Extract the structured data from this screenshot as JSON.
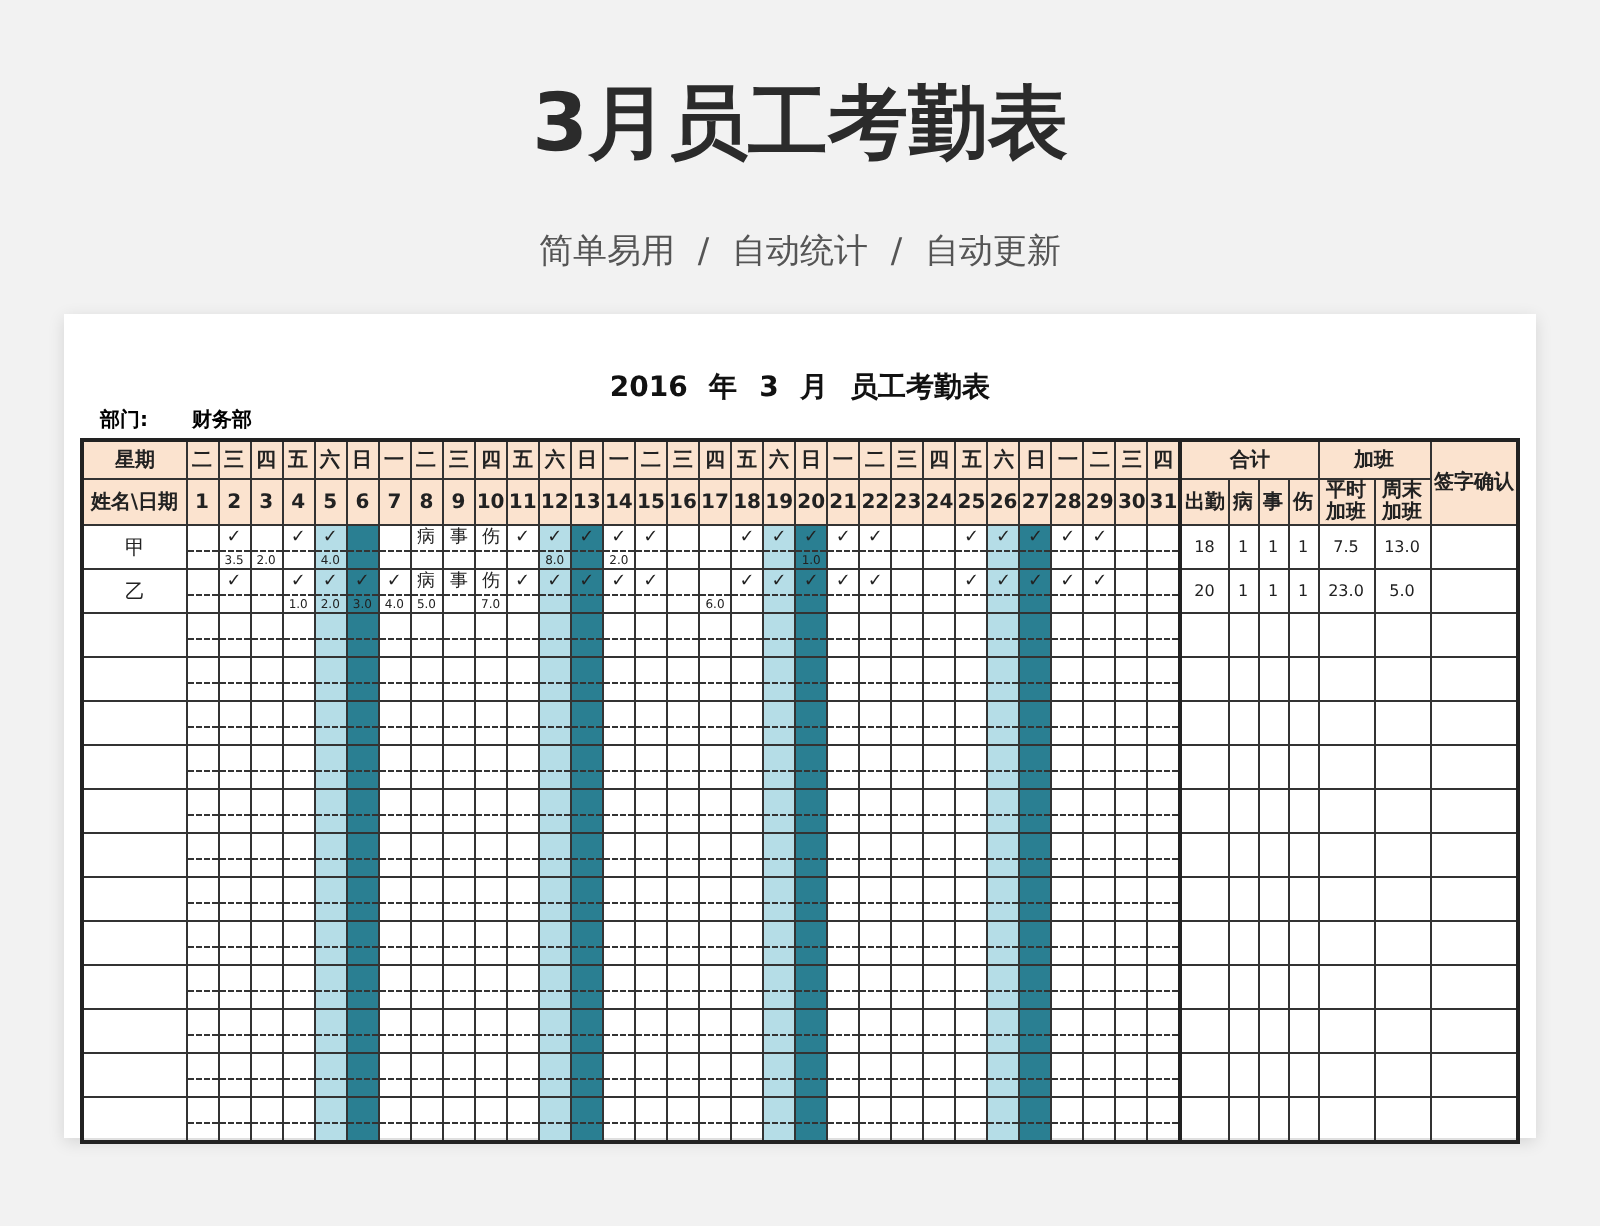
{
  "title": "3月员工考勤表",
  "subtitle": "简单易用 / 自动统计 / 自动更新",
  "sheet": {
    "title": "2016 年 3 月 员工考勤表",
    "department_label": "部门:",
    "department": "财务部",
    "weekday_header": "星期",
    "name_date_header": "姓名\\日期",
    "days": [
      {
        "weekday": "二",
        "date": "1",
        "kind": "weekday"
      },
      {
        "weekday": "三",
        "date": "2",
        "kind": "weekday"
      },
      {
        "weekday": "四",
        "date": "3",
        "kind": "weekday"
      },
      {
        "weekday": "五",
        "date": "4",
        "kind": "weekday"
      },
      {
        "weekday": "六",
        "date": "5",
        "kind": "saturday"
      },
      {
        "weekday": "日",
        "date": "6",
        "kind": "sunday"
      },
      {
        "weekday": "一",
        "date": "7",
        "kind": "weekday"
      },
      {
        "weekday": "二",
        "date": "8",
        "kind": "weekday"
      },
      {
        "weekday": "三",
        "date": "9",
        "kind": "weekday"
      },
      {
        "weekday": "四",
        "date": "10",
        "kind": "weekday"
      },
      {
        "weekday": "五",
        "date": "11",
        "kind": "weekday"
      },
      {
        "weekday": "六",
        "date": "12",
        "kind": "saturday"
      },
      {
        "weekday": "日",
        "date": "13",
        "kind": "sunday"
      },
      {
        "weekday": "一",
        "date": "14",
        "kind": "weekday"
      },
      {
        "weekday": "二",
        "date": "15",
        "kind": "weekday"
      },
      {
        "weekday": "三",
        "date": "16",
        "kind": "weekday"
      },
      {
        "weekday": "四",
        "date": "17",
        "kind": "weekday"
      },
      {
        "weekday": "五",
        "date": "18",
        "kind": "weekday"
      },
      {
        "weekday": "六",
        "date": "19",
        "kind": "saturday"
      },
      {
        "weekday": "日",
        "date": "20",
        "kind": "sunday"
      },
      {
        "weekday": "一",
        "date": "21",
        "kind": "weekday"
      },
      {
        "weekday": "二",
        "date": "22",
        "kind": "weekday"
      },
      {
        "weekday": "三",
        "date": "23",
        "kind": "weekday"
      },
      {
        "weekday": "四",
        "date": "24",
        "kind": "weekday"
      },
      {
        "weekday": "五",
        "date": "25",
        "kind": "weekday"
      },
      {
        "weekday": "六",
        "date": "26",
        "kind": "saturday"
      },
      {
        "weekday": "日",
        "date": "27",
        "kind": "sunday"
      },
      {
        "weekday": "一",
        "date": "28",
        "kind": "weekday"
      },
      {
        "weekday": "二",
        "date": "29",
        "kind": "weekday"
      },
      {
        "weekday": "三",
        "date": "30",
        "kind": "weekday"
      },
      {
        "weekday": "四",
        "date": "31",
        "kind": "weekday"
      }
    ],
    "totals_header": "合计",
    "overtime_header": "加班",
    "signature_header": "签字确认",
    "summary_columns": [
      "出勤",
      "病",
      "事",
      "伤",
      "平时加班",
      "周末加班"
    ],
    "rows": [
      {
        "name": "甲",
        "cells": [
          {},
          {
            "mark": "✓",
            "overtime": "3.5"
          },
          {
            "overtime": "2.0"
          },
          {
            "mark": "✓"
          },
          {
            "mark": "✓",
            "overtime": "4.0"
          },
          {},
          {},
          {
            "mark": "病"
          },
          {
            "mark": "事"
          },
          {
            "mark": "伤"
          },
          {
            "mark": "✓"
          },
          {
            "mark": "✓",
            "overtime": "8.0"
          },
          {
            "mark": "✓"
          },
          {
            "mark": "✓",
            "overtime": "2.0"
          },
          {
            "mark": "✓"
          },
          {},
          {},
          {
            "mark": "✓"
          },
          {
            "mark": "✓"
          },
          {
            "mark": "✓",
            "overtime": "1.0"
          },
          {
            "mark": "✓"
          },
          {
            "mark": "✓"
          },
          {},
          {},
          {
            "mark": "✓"
          },
          {
            "mark": "✓"
          },
          {
            "mark": "✓"
          },
          {
            "mark": "✓"
          },
          {
            "mark": "✓"
          },
          {},
          {}
        ],
        "totals": [
          "18",
          "1",
          "1",
          "1",
          "7.5",
          "13.0"
        ]
      },
      {
        "name": "乙",
        "cells": [
          {},
          {
            "mark": "✓"
          },
          {},
          {
            "mark": "✓",
            "overtime": "1.0"
          },
          {
            "mark": "✓",
            "overtime": "2.0"
          },
          {
            "mark": "✓",
            "overtime": "3.0"
          },
          {
            "mark": "✓",
            "overtime": "4.0"
          },
          {
            "mark": "病",
            "overtime": "5.0"
          },
          {
            "mark": "事"
          },
          {
            "mark": "伤",
            "overtime": "7.0"
          },
          {
            "mark": "✓"
          },
          {
            "mark": "✓"
          },
          {
            "mark": "✓"
          },
          {
            "mark": "✓"
          },
          {
            "mark": "✓"
          },
          {},
          {
            "overtime": "6.0"
          },
          {
            "mark": "✓"
          },
          {
            "mark": "✓"
          },
          {
            "mark": "✓"
          },
          {
            "mark": "✓"
          },
          {
            "mark": "✓"
          },
          {},
          {},
          {
            "mark": "✓"
          },
          {
            "mark": "✓"
          },
          {
            "mark": "✓"
          },
          {
            "mark": "✓"
          },
          {
            "mark": "✓"
          },
          {},
          {}
        ],
        "totals": [
          "20",
          "1",
          "1",
          "1",
          "23.0",
          "5.0"
        ]
      }
    ]
  }
}
